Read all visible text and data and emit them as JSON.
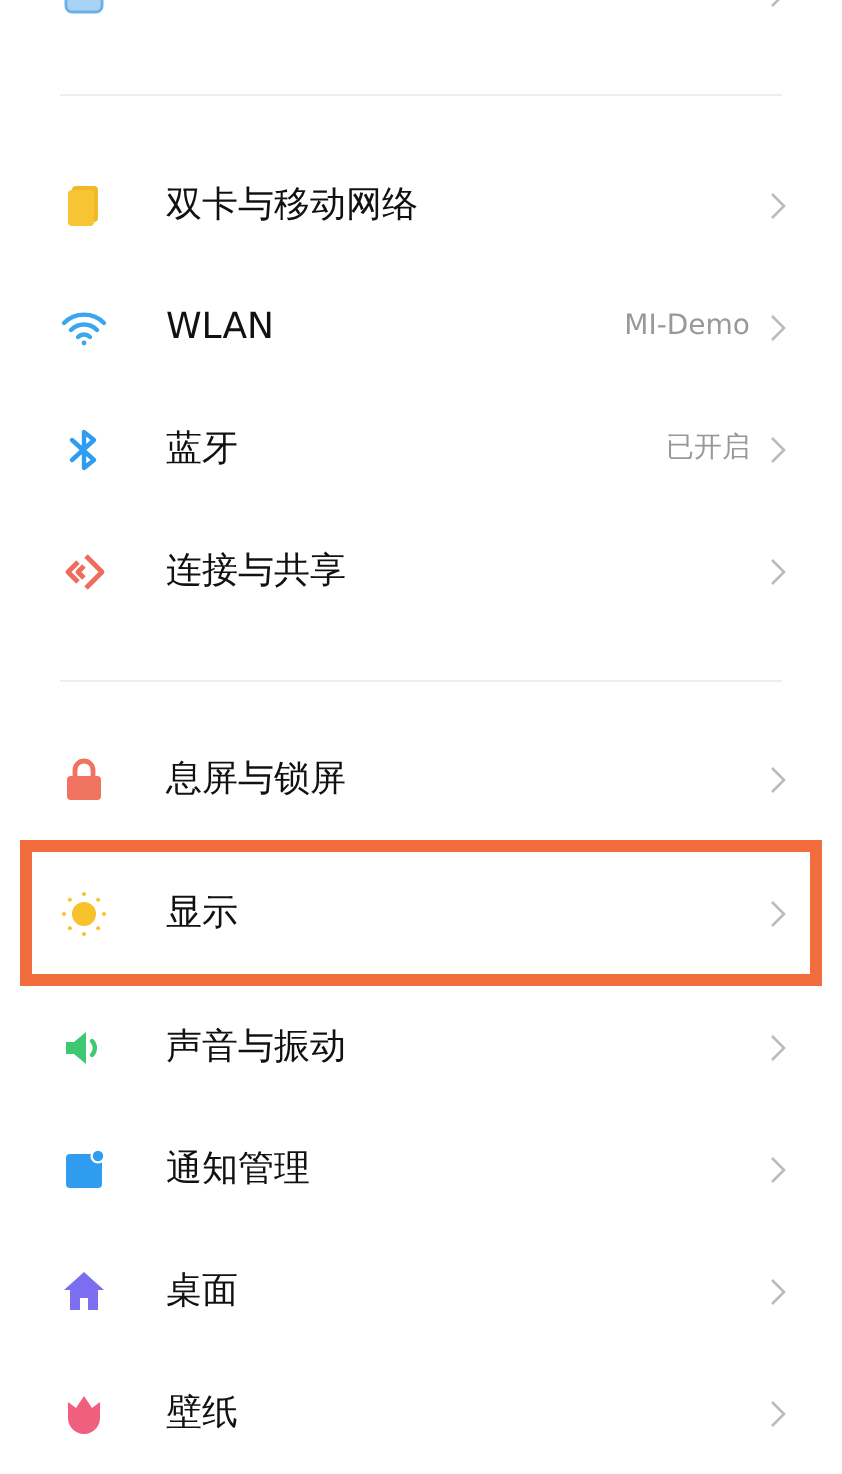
{
  "sections": [
    {
      "items": [
        {
          "kind": "device",
          "selected": false
        }
      ]
    },
    {
      "items": [
        {
          "kind": "sim",
          "label": "双卡与移动网络",
          "selected": false
        },
        {
          "kind": "wifi",
          "label": "WLAN",
          "value": "MI-Demo",
          "selected": false
        },
        {
          "kind": "bluetooth",
          "label": "蓝牙",
          "value": "已开启",
          "selected": false
        },
        {
          "kind": "share",
          "label": "连接与共享",
          "selected": false
        }
      ]
    },
    {
      "items": [
        {
          "kind": "lock",
          "label": "息屏与锁屏",
          "selected": false
        },
        {
          "kind": "sun",
          "label": "显示",
          "selected": true
        },
        {
          "kind": "sound",
          "label": "声音与振动",
          "selected": false
        },
        {
          "kind": "notify",
          "label": "通知管理",
          "selected": false
        },
        {
          "kind": "home",
          "label": "桌面",
          "selected": false
        },
        {
          "kind": "tulip",
          "label": "壁纸",
          "selected": false
        }
      ]
    }
  ]
}
